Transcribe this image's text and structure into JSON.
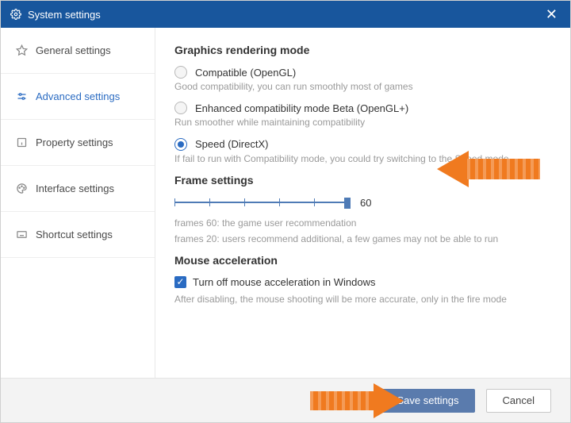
{
  "window": {
    "title": "System settings"
  },
  "sidebar": {
    "items": [
      {
        "label": "General settings"
      },
      {
        "label": "Advanced settings"
      },
      {
        "label": "Property settings"
      },
      {
        "label": "Interface settings"
      },
      {
        "label": "Shortcut settings"
      }
    ],
    "selected_index": 1
  },
  "graphics": {
    "title": "Graphics rendering mode",
    "opt1": {
      "label": "Compatible (OpenGL)",
      "desc": "Good compatibility, you can run smoothly most of games"
    },
    "opt2": {
      "label": "Enhanced compatibility mode Beta (OpenGL+)",
      "desc": "Run smoother while maintaining compatibility"
    },
    "opt3": {
      "label": "Speed (DirectX)",
      "desc": " If fail to run with Compatibility mode, you could try switching to the Speed mode"
    },
    "selected": "opt3"
  },
  "frames": {
    "title": "Frame settings",
    "value": 60,
    "min": 20,
    "max": 60,
    "desc1": "frames 60: the game user recommendation",
    "desc2": "frames 20: users recommend additional, a few games may not be able to run"
  },
  "mouse": {
    "title": "Mouse acceleration",
    "checkbox_label": "Turn off mouse acceleration in Windows",
    "checked": true,
    "desc": "After disabling, the mouse shooting will be more accurate, only in the fire mode"
  },
  "footer": {
    "save": "Save settings",
    "cancel": "Cancel"
  },
  "colors": {
    "accent": "#2a6bc2",
    "titlebar": "#18569d",
    "arrow": "#f07a1f"
  }
}
